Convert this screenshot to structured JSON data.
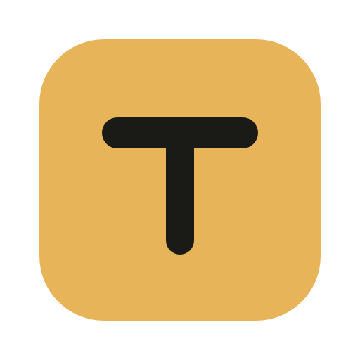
{
  "icon": {
    "name": "letter-t-app-icon",
    "glyph": "T",
    "background_color": "#E8B45A",
    "glyph_color": "#1A1A17"
  }
}
